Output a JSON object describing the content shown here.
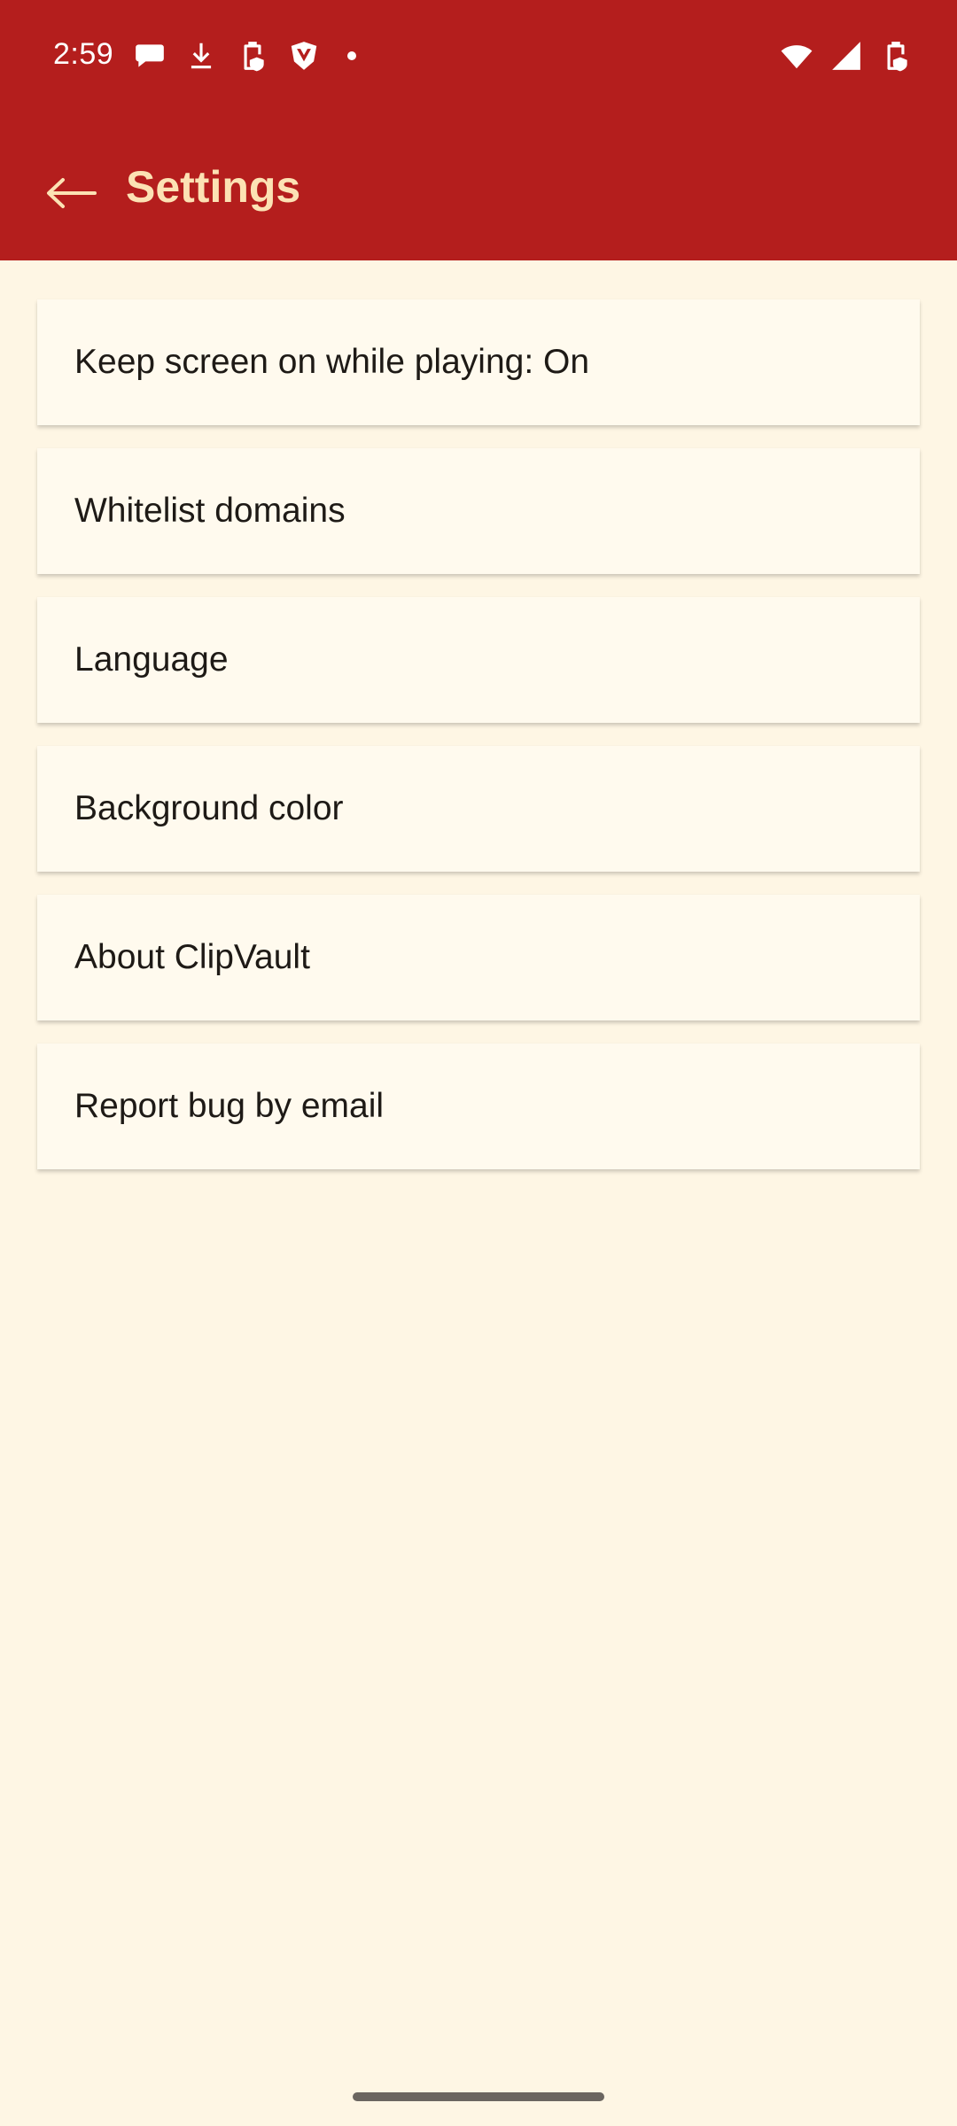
{
  "status_bar": {
    "time": "2:59",
    "left_icons": [
      "chat-bubble-icon",
      "download-icon",
      "battery-saver-icon",
      "shield-v-icon",
      "notification-dot"
    ],
    "right_icons": [
      "wifi-icon",
      "cell-signal-icon",
      "battery-icon"
    ]
  },
  "app_bar": {
    "title": "Settings",
    "back_icon": "arrow-left-icon"
  },
  "settings": {
    "items": [
      {
        "label": "Keep screen on while playing: On"
      },
      {
        "label": "Whitelist domains"
      },
      {
        "label": "Language"
      },
      {
        "label": "Background color"
      },
      {
        "label": "About ClipVault"
      },
      {
        "label": "Report bug by email"
      }
    ]
  },
  "colors": {
    "app_bar": "#B41E1D",
    "title_text": "#FCE2B4",
    "background": "#FEF6E4",
    "card": "#FFFAEE",
    "item_text": "#1E1A16"
  }
}
